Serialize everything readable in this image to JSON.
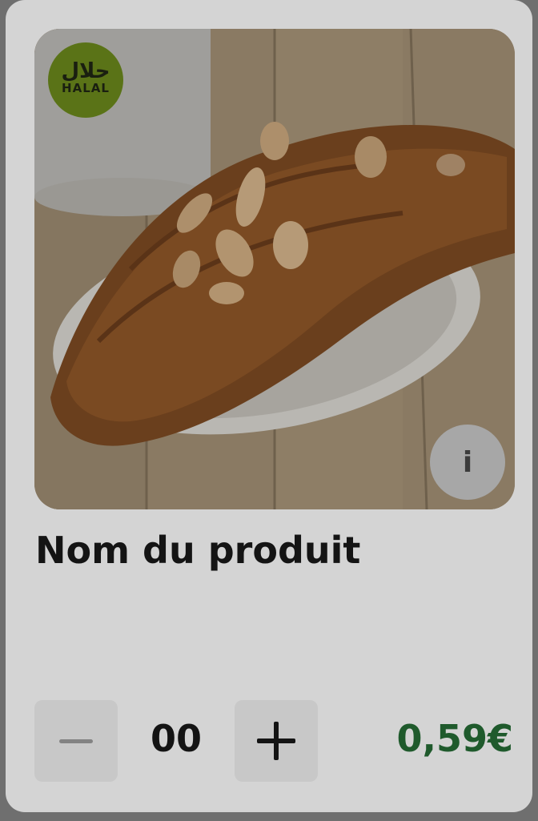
{
  "product": {
    "name": "Nom du produit",
    "image_alt": "croissant",
    "badge": {
      "arabic": "حلال",
      "latin": "HALAL"
    },
    "info_icon": "i"
  },
  "stepper": {
    "quantity": "00"
  },
  "price": "0,59€",
  "colors": {
    "accent": "#1f5a2c",
    "halal_badge": "#5a7317"
  }
}
